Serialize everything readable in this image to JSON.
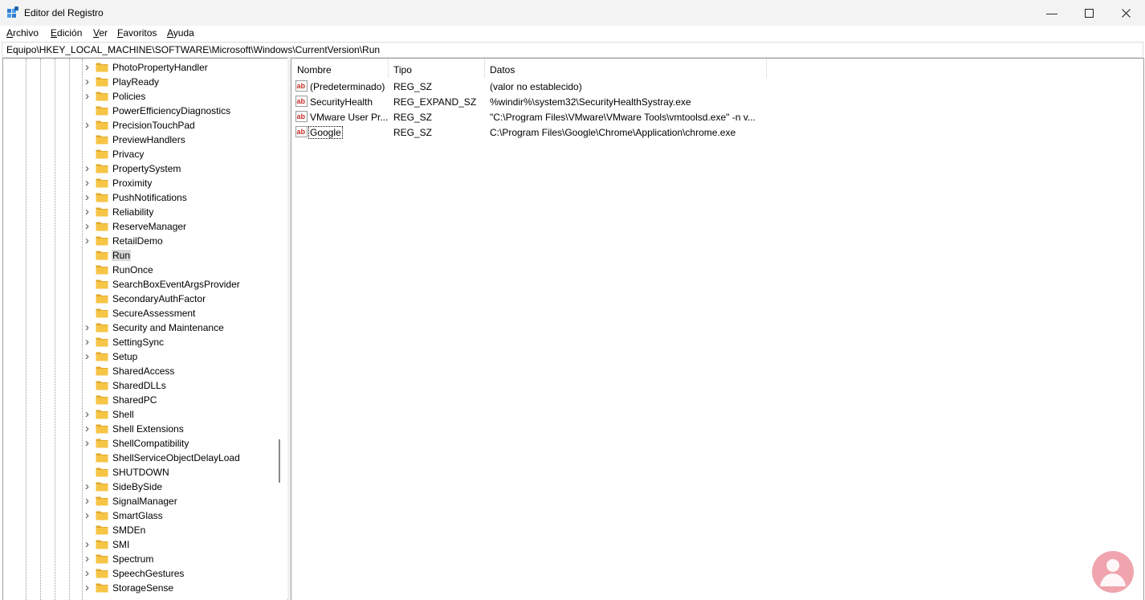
{
  "window": {
    "title": "Editor del Registro"
  },
  "menu": [
    {
      "label": "Archivo",
      "accel": "A",
      "rest": "rchivo"
    },
    {
      "label": "Edición",
      "accel": "E",
      "rest": "dición"
    },
    {
      "label": "Ver",
      "accel": "V",
      "rest": "er"
    },
    {
      "label": "Favoritos",
      "accel": "F",
      "rest": "avoritos"
    },
    {
      "label": "Ayuda",
      "accel": "A",
      "rest": "yuda"
    }
  ],
  "address": "Equipo\\HKEY_LOCAL_MACHINE\\SOFTWARE\\Microsoft\\Windows\\CurrentVersion\\Run",
  "tree": [
    {
      "label": "PhotoPropertyHandler",
      "expandable": true
    },
    {
      "label": "PlayReady",
      "expandable": true
    },
    {
      "label": "Policies",
      "expandable": true
    },
    {
      "label": "PowerEfficiencyDiagnostics",
      "expandable": false
    },
    {
      "label": "PrecisionTouchPad",
      "expandable": true
    },
    {
      "label": "PreviewHandlers",
      "expandable": false
    },
    {
      "label": "Privacy",
      "expandable": false
    },
    {
      "label": "PropertySystem",
      "expandable": true
    },
    {
      "label": "Proximity",
      "expandable": true
    },
    {
      "label": "PushNotifications",
      "expandable": true
    },
    {
      "label": "Reliability",
      "expandable": true
    },
    {
      "label": "ReserveManager",
      "expandable": true
    },
    {
      "label": "RetailDemo",
      "expandable": true
    },
    {
      "label": "Run",
      "expandable": false,
      "selected": true
    },
    {
      "label": "RunOnce",
      "expandable": false
    },
    {
      "label": "SearchBoxEventArgsProvider",
      "expandable": false
    },
    {
      "label": "SecondaryAuthFactor",
      "expandable": false
    },
    {
      "label": "SecureAssessment",
      "expandable": false
    },
    {
      "label": "Security and Maintenance",
      "expandable": true
    },
    {
      "label": "SettingSync",
      "expandable": true
    },
    {
      "label": "Setup",
      "expandable": true
    },
    {
      "label": "SharedAccess",
      "expandable": false
    },
    {
      "label": "SharedDLLs",
      "expandable": false
    },
    {
      "label": "SharedPC",
      "expandable": false
    },
    {
      "label": "Shell",
      "expandable": true
    },
    {
      "label": "Shell Extensions",
      "expandable": true
    },
    {
      "label": "ShellCompatibility",
      "expandable": true
    },
    {
      "label": "ShellServiceObjectDelayLoad",
      "expandable": false
    },
    {
      "label": "SHUTDOWN",
      "expandable": false
    },
    {
      "label": "SideBySide",
      "expandable": true
    },
    {
      "label": "SignalManager",
      "expandable": true
    },
    {
      "label": "SmartGlass",
      "expandable": true
    },
    {
      "label": "SMDEn",
      "expandable": false
    },
    {
      "label": "SMI",
      "expandable": true
    },
    {
      "label": "Spectrum",
      "expandable": true
    },
    {
      "label": "SpeechGestures",
      "expandable": true
    },
    {
      "label": "StorageSense",
      "expandable": true
    }
  ],
  "columns": {
    "name": "Nombre",
    "type": "Tipo",
    "data": "Datos"
  },
  "values": [
    {
      "name": "(Predeterminado)",
      "type": "REG_SZ",
      "data": "(valor no establecido)"
    },
    {
      "name": "SecurityHealth",
      "type": "REG_EXPAND_SZ",
      "data": "%windir%\\system32\\SecurityHealthSystray.exe"
    },
    {
      "name": "VMware User Pr...",
      "type": "REG_SZ",
      "data": "\"C:\\Program Files\\VMware\\VMware Tools\\vmtoolsd.exe\" -n v..."
    },
    {
      "name": "Google",
      "type": "REG_SZ",
      "data": "C:\\Program Files\\Google\\Chrome\\Application\\chrome.exe",
      "focused": true
    }
  ],
  "colors": {
    "folder": "#f6c546",
    "folder_dark": "#e2a92b",
    "ab_red": "#c4322a",
    "selection": "#d9d9d9",
    "watermark": "#e25a6c"
  },
  "icons": {
    "app": "registry-editor-icon",
    "folder": "folder-icon",
    "value": "string-value-icon",
    "expand": "chevron-right-icon",
    "watermark": "person-logo-icon"
  }
}
